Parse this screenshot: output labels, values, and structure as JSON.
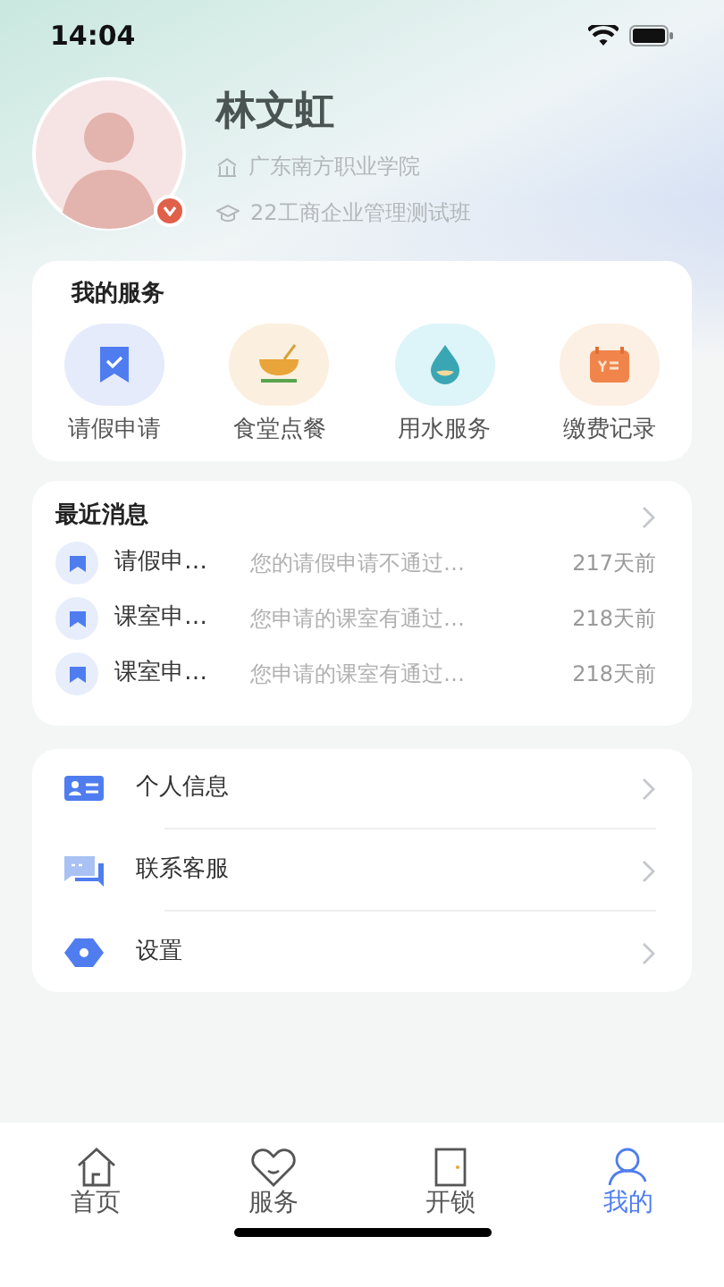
{
  "status_bar": {
    "time": "14:04"
  },
  "profile": {
    "name": "林文虹",
    "school": "广东南方职业学院",
    "class": "22工商企业管理测试班",
    "verified": true
  },
  "services": {
    "title": "我的服务",
    "items": [
      {
        "kind": "leave",
        "label": "请假申请"
      },
      {
        "kind": "canteen",
        "label": "食堂点餐"
      },
      {
        "kind": "water",
        "label": "用水服务"
      },
      {
        "kind": "payment",
        "label": "缴费记录"
      }
    ]
  },
  "messages": {
    "title": "最近消息",
    "items": [
      {
        "title": "请假申…",
        "summary": "您的请假申请不通过…",
        "time": "217天前"
      },
      {
        "title": "课室申…",
        "summary": "您申请的课室有通过…",
        "time": "218天前"
      },
      {
        "title": "课室申…",
        "summary": "您申请的课室有通过…",
        "time": "218天前"
      }
    ]
  },
  "menu": [
    {
      "kind": "profile",
      "label": "个人信息"
    },
    {
      "kind": "support",
      "label": "联系客服"
    },
    {
      "kind": "settings",
      "label": "设置"
    }
  ],
  "tab_bar": [
    {
      "kind": "home",
      "label": "首页",
      "selected": false
    },
    {
      "kind": "service",
      "label": "服务",
      "selected": false
    },
    {
      "kind": "door",
      "label": "开锁",
      "selected": false
    },
    {
      "kind": "me",
      "label": "我的",
      "selected": true
    }
  ]
}
